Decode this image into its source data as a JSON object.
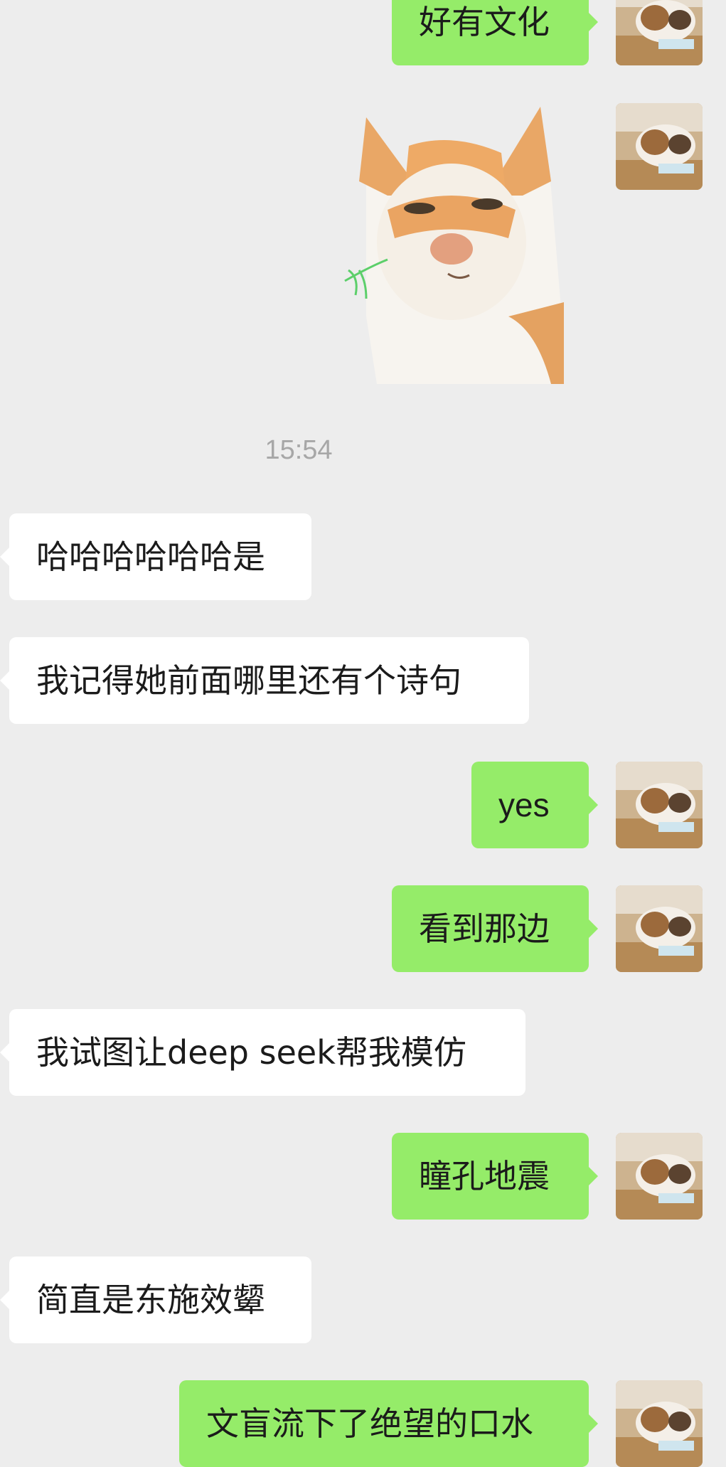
{
  "timestamp": "15:54",
  "sticker_icon": "cat-meme-sticker",
  "avatar_icon": "cat-avatar",
  "messages": [
    {
      "side": "out",
      "text": "好有文化"
    },
    {
      "side": "in",
      "text": "哈哈哈哈哈哈是"
    },
    {
      "side": "in",
      "text": "我记得她前面哪里还有个诗句"
    },
    {
      "side": "out",
      "text": "yes"
    },
    {
      "side": "out",
      "text": "看到那边"
    },
    {
      "side": "in",
      "text": "我试图让deep seek帮我模仿"
    },
    {
      "side": "out",
      "text": "瞳孔地震"
    },
    {
      "side": "in",
      "text": "简直是东施效颦"
    },
    {
      "side": "out",
      "text": "文盲流下了绝望的口水"
    }
  ],
  "colors": {
    "background": "#ededed",
    "outgoing_bubble": "#95ec69",
    "incoming_bubble": "#ffffff"
  }
}
